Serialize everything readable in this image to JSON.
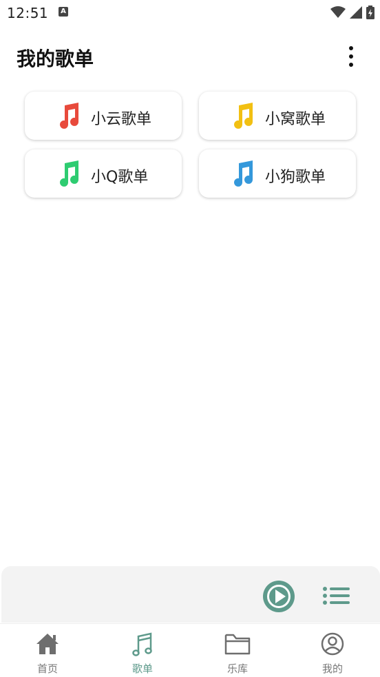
{
  "status_bar": {
    "time": "12:51",
    "notification_icon": "A"
  },
  "header": {
    "title": "我的歌单",
    "menu_icon": "more-vertical-icon"
  },
  "playlists": [
    {
      "label": "小云歌单",
      "icon": "music-note-icon",
      "color": "#e84a3c"
    },
    {
      "label": "小窝歌单",
      "icon": "music-note-icon",
      "color": "#f2c012"
    },
    {
      "label": "小Q歌单",
      "icon": "music-note-icon",
      "color": "#2ecc71"
    },
    {
      "label": "小狗歌单",
      "icon": "music-note-icon",
      "color": "#3498db"
    }
  ],
  "player": {
    "play_icon": "play-circle-icon",
    "list_icon": "playlist-icon",
    "accent": "#5e9a8b"
  },
  "nav": {
    "items": [
      {
        "label": "首页",
        "icon": "home-icon",
        "active": false
      },
      {
        "label": "歌单",
        "icon": "music-note-icon",
        "active": true
      },
      {
        "label": "乐库",
        "icon": "folder-icon",
        "active": false
      },
      {
        "label": "我的",
        "icon": "profile-icon",
        "active": false
      }
    ]
  }
}
